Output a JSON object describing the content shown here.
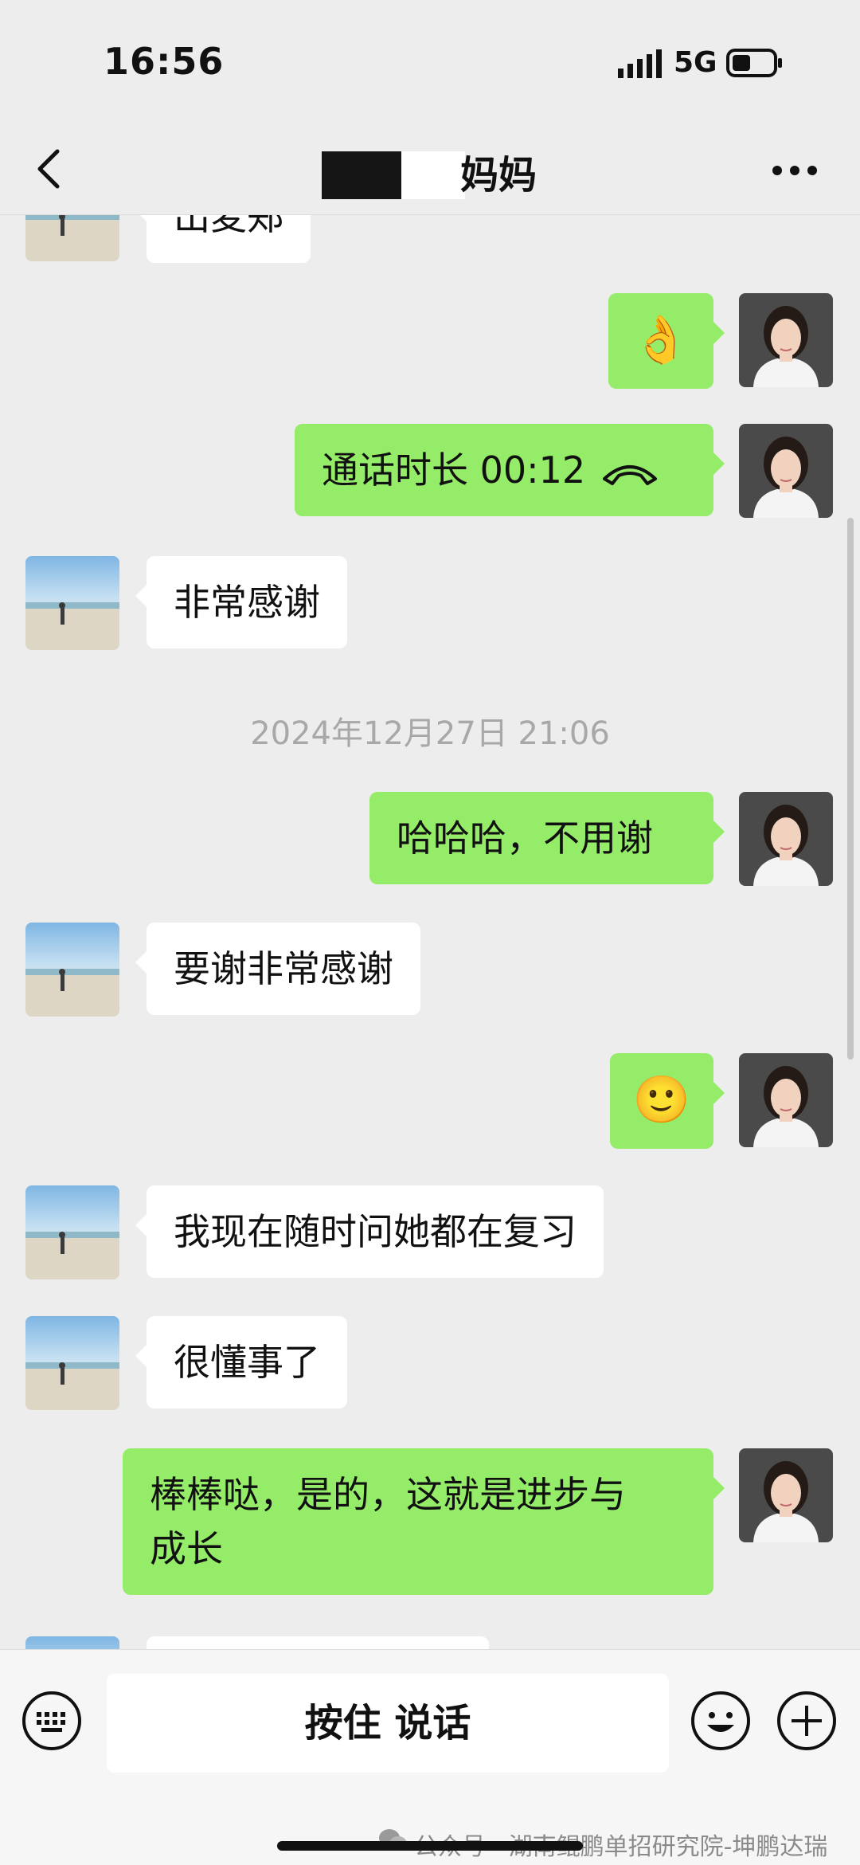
{
  "status_bar": {
    "time": "16:56",
    "network": "5G"
  },
  "header": {
    "title": "妈妈",
    "back_icon": "chevron-left-icon",
    "more_icon": "more-dots-icon"
  },
  "messages": [
    {
      "side": "in",
      "text": "出麦郑",
      "partial": true
    },
    {
      "side": "out",
      "emoji": "👌"
    },
    {
      "side": "out",
      "text": "通话时长 00:12",
      "icon": "phone-hangup-icon"
    },
    {
      "side": "in",
      "text": "非常感谢"
    },
    {
      "timestamp": "2024年12月27日 21:06"
    },
    {
      "side": "out",
      "text": "哈哈哈，不用谢"
    },
    {
      "side": "in",
      "text": "要谢非常感谢"
    },
    {
      "side": "out",
      "emoji": "🙂"
    },
    {
      "side": "in",
      "text": "我现在随时问她都在复习"
    },
    {
      "side": "in",
      "text": "很懂事了"
    },
    {
      "side": "out",
      "text_line1": "棒棒哒，是的，这就是进步与",
      "text_line2": "成长"
    }
  ],
  "input_bar": {
    "talk_label": "按住 说话",
    "icons": [
      "keyboard-icon",
      "emoji-icon",
      "plus-icon"
    ]
  },
  "watermark": {
    "text": "公众号 · 湖南鲲鹏单招研究院-坤鹏达瑞"
  },
  "colors": {
    "background": "#ededed",
    "out_bubble": "#95ec69",
    "in_bubble": "#ffffff"
  }
}
